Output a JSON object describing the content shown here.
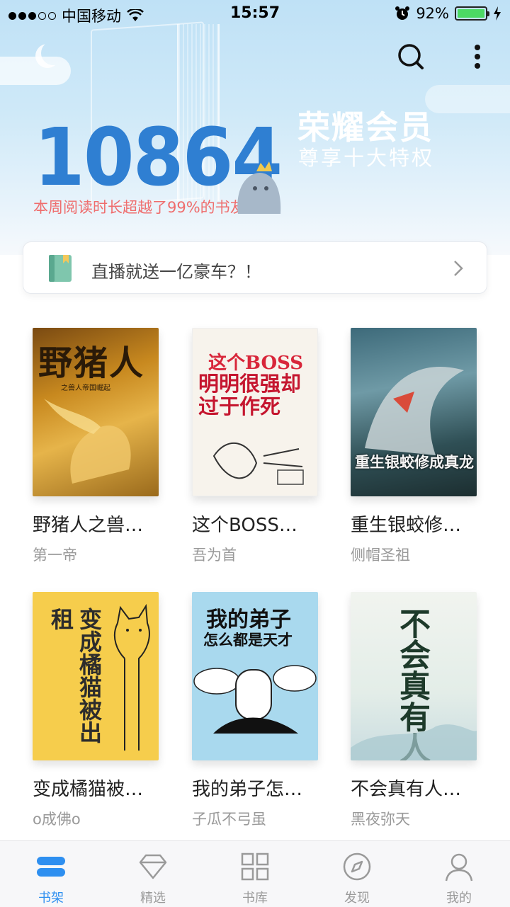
{
  "status_bar": {
    "carrier": "中国移动",
    "time": "15:57",
    "battery": "92%"
  },
  "header": {
    "read_number": "10864",
    "read_stat": "本周阅读时长超越了99%的书友",
    "vip_title": "荣耀会员",
    "vip_subtitle": "尊享十大特权",
    "search_icon": "search-icon",
    "more_icon": "more-vertical-icon"
  },
  "notice": {
    "text": "直播就送一亿豪车？！"
  },
  "books": [
    {
      "title": "野猪人之兽…",
      "author": "第一帝",
      "cover_text": "野猪人",
      "cover_sub": "之兽人帝国崛起"
    },
    {
      "title": "这个BOSS…",
      "author": "吾为首",
      "cover_text": "这个BOSS",
      "cover_sub": "明明很强却过于作死"
    },
    {
      "title": "重生银蛟修…",
      "author": "侧帽圣祖",
      "cover_text": "重生银蛟修成真龙"
    },
    {
      "title": "变成橘猫被…",
      "author": "o成佛o",
      "cover_text": "变成橘猫被出租"
    },
    {
      "title": "我的弟子怎…",
      "author": "子瓜不弓虽",
      "cover_text": "我的弟子",
      "cover_sub": "怎么都是天才"
    },
    {
      "title": "不会真有人…",
      "author": "黑夜弥天",
      "cover_text": "不会真有人"
    }
  ],
  "tabbar": {
    "items": [
      {
        "label": "书架",
        "icon": "bookshelf-icon",
        "active": true
      },
      {
        "label": "精选",
        "icon": "diamond-icon",
        "active": false
      },
      {
        "label": "书库",
        "icon": "grid-icon",
        "active": false
      },
      {
        "label": "发现",
        "icon": "compass-icon",
        "active": false
      },
      {
        "label": "我的",
        "icon": "user-icon",
        "active": false
      }
    ]
  },
  "colors": {
    "accent": "#2e8ff0",
    "number": "#2f7fd2",
    "stat": "#ef6d6d"
  }
}
